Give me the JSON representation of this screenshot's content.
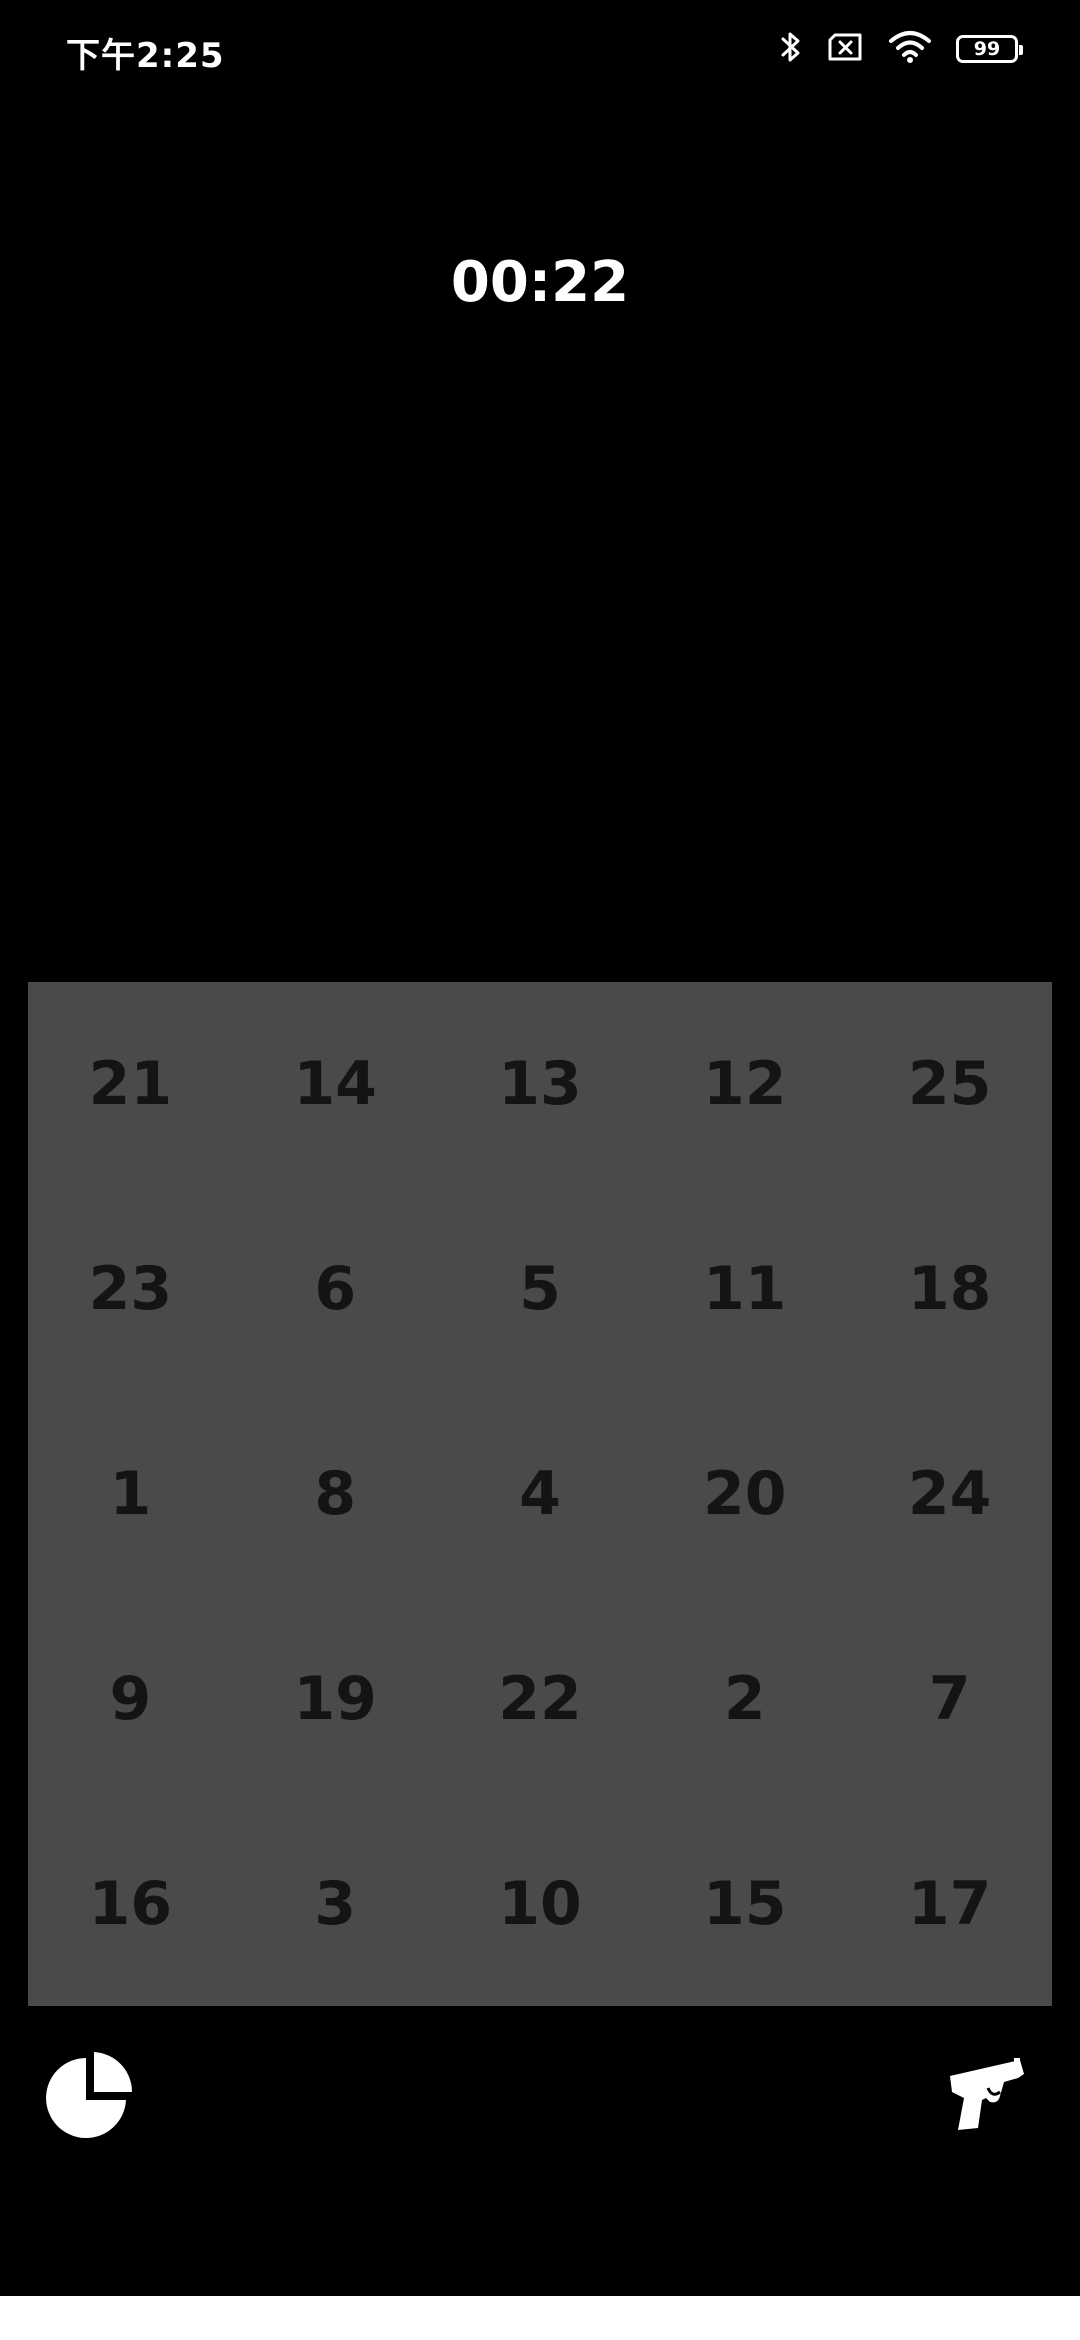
{
  "status_bar": {
    "time": "下午2:25",
    "battery_level": "99",
    "icons": [
      "bluetooth-icon",
      "sim-disabled-icon",
      "wifi-icon",
      "battery-icon"
    ]
  },
  "timer": {
    "value": "00:22"
  },
  "board": {
    "cells": [
      "21",
      "14",
      "13",
      "12",
      "25",
      "23",
      "6",
      "5",
      "11",
      "18",
      "1",
      "8",
      "4",
      "20",
      "24",
      "9",
      "19",
      "22",
      "2",
      "7",
      "16",
      "3",
      "10",
      "15",
      "17"
    ],
    "colors": {
      "background": "#4a4a4a",
      "number": "#141414"
    }
  },
  "toolbar": {
    "left_icon": "pie-chart-icon",
    "right_icon": "pistol-icon"
  },
  "colors": {
    "page_background": "#000000",
    "foreground": "#ffffff"
  }
}
